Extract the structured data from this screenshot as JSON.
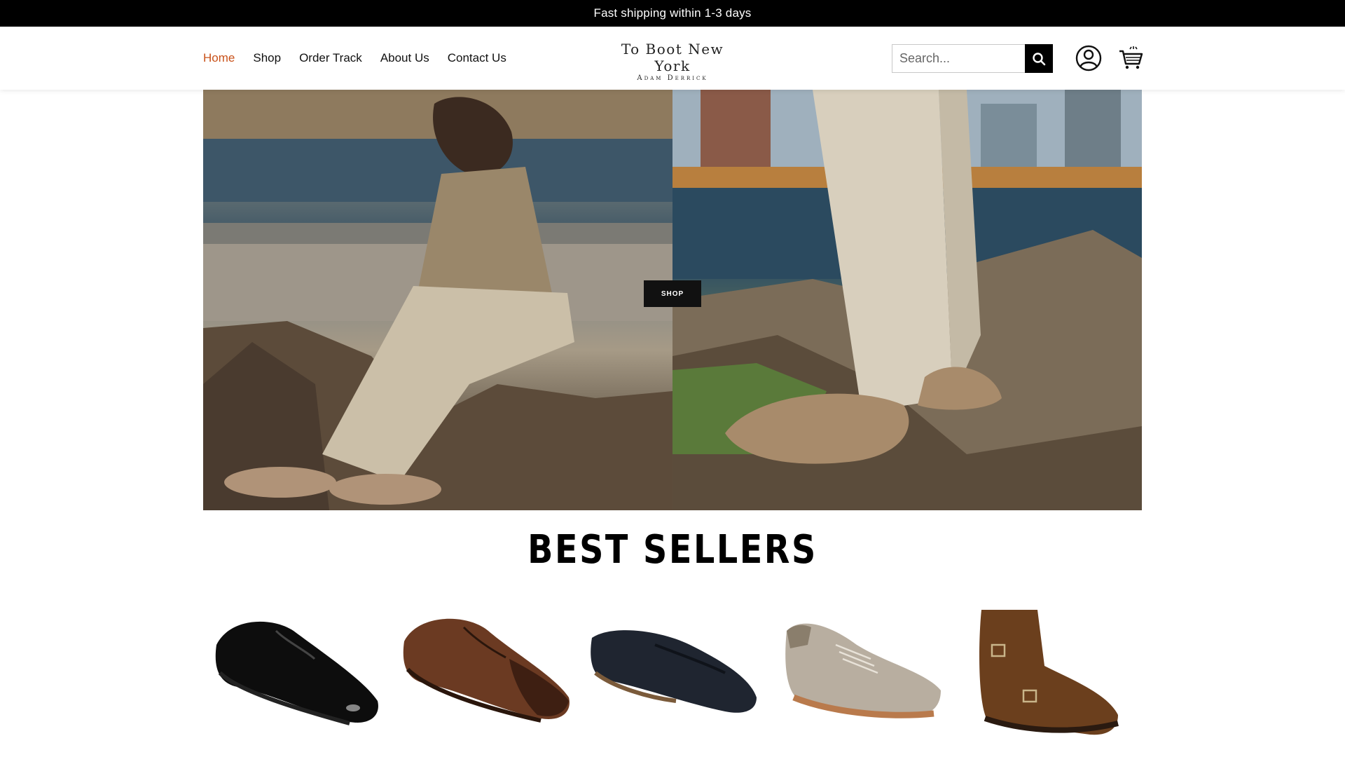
{
  "announcement": {
    "text": "Fast shipping within 1-3 days"
  },
  "nav": {
    "items": [
      {
        "label": "Home",
        "active": true
      },
      {
        "label": "Shop",
        "active": false
      },
      {
        "label": "Order Track",
        "active": false
      },
      {
        "label": "About Us",
        "active": false
      },
      {
        "label": "Contact Us",
        "active": false
      }
    ]
  },
  "logo": {
    "line1": "To Boot New York",
    "line2": "Adam Derrick"
  },
  "search": {
    "placeholder": "Search..."
  },
  "icons": {
    "search": "search-icon",
    "account": "user-icon",
    "cart": "cart-icon"
  },
  "hero": {
    "cta_label": "SHOP"
  },
  "best_sellers": {
    "title": "BEST SELLERS",
    "products": [
      {
        "name": "black-patent-derby",
        "color": "#0d0d0d"
      },
      {
        "name": "brown-leather-derby",
        "color": "#5a3020"
      },
      {
        "name": "navy-suede-loafer",
        "color": "#1f2530"
      },
      {
        "name": "grey-suede-sneaker",
        "color": "#b8aea0"
      },
      {
        "name": "brown-suede-monk-boot",
        "color": "#6b3f1d"
      }
    ]
  },
  "colors": {
    "accent": "#c9521a",
    "bar": "#000000"
  }
}
